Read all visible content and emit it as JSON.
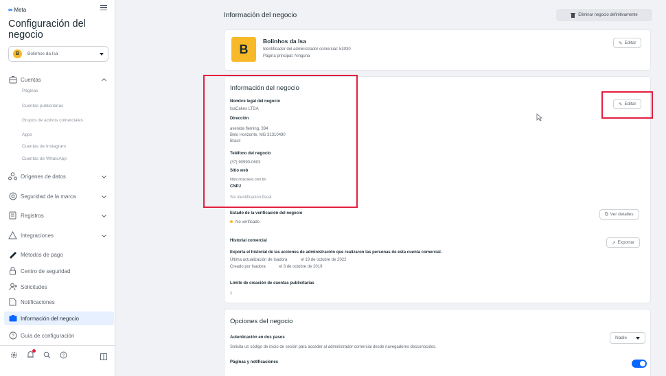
{
  "sidebar": {
    "brand": "Meta",
    "title": "Configuración del negocio",
    "business_select": {
      "initial": "B",
      "name": "Bolinhos da Isa"
    },
    "sections": [
      {
        "label": "Cuentas",
        "icon": "accounts-icon"
      },
      {
        "label": "Orígenes de datos",
        "icon": "data-sources-icon"
      },
      {
        "label": "Seguridad de la marca",
        "icon": "brand-safety-icon"
      },
      {
        "label": "Registros",
        "icon": "registers-icon"
      },
      {
        "label": "Integraciones",
        "icon": "integrations-icon"
      },
      {
        "label": "Métodos de pago",
        "icon": "payment-icon"
      },
      {
        "label": "Centro de seguridad",
        "icon": "security-center-icon"
      },
      {
        "label": "Solicitudes",
        "icon": "requests-icon"
      },
      {
        "label": "Notificaciones",
        "icon": "notifications-icon"
      },
      {
        "label": "Información del negocio",
        "icon": "business-info-icon"
      },
      {
        "label": "Guía de configuración",
        "icon": "setup-guide-icon"
      }
    ],
    "accounts_sub": [
      "Páginas",
      "Cuentas publicitarias",
      "Grupos de activos comerciales",
      "Apps",
      "Cuentas de Instagram",
      "Cuentas de WhatsApp"
    ],
    "bottom_icons": [
      "settings-icon",
      "notifications-bell-icon",
      "search-icon",
      "help-icon",
      "panel-icon"
    ]
  },
  "main": {
    "title": "Información del negocio",
    "delete_button": "Eliminar negocio definitivamente",
    "profile": {
      "initial": "B",
      "name": "Bolinhos da Isa",
      "admin_id": "Identificador del administrador comercial: 53030",
      "main_page": "Página principal: Ninguna",
      "edit": "Editar"
    },
    "info": {
      "title": "Información del negocio",
      "edit": "Editar",
      "legal_name_label": "Nombre legal del negocio",
      "legal_name": "IsaCakes LTDA",
      "address_label": "Dirección",
      "address_lines": [
        "avenida fleming, 394",
        "Belo Horizonte, MG 31310490",
        "Brasil"
      ],
      "phone_label": "Teléfono del negocio",
      "phone": "(37) 90990-0603",
      "website_label": "Sitio web",
      "website": "https://isacakes.com.br/",
      "cnpj_label": "CNPJ",
      "cnpj": "Sin identificación fiscal",
      "verification_label": "Estado de la verificación del negocio",
      "verification_status": "No verificado",
      "view_details": "Ver detalles",
      "history_label": "Historial comercial",
      "history_desc": "Exporta el historial de las acciones de administración que realizaron las personas de esta cuenta comercial.",
      "history_update": "Última actualización de Isadora",
      "history_update_date": "el 19 de octubre de 2022",
      "history_created": "Creado por Isadora",
      "history_created_date": "el 3 de octubre de 2019",
      "export": "Exportar",
      "ad_limit_label": "Límite de creación de cuentas publicitarias",
      "ad_limit": "1"
    },
    "options": {
      "title": "Opciones del negocio",
      "twofa_label": "Autenticación en dos pasos",
      "twofa_desc": "Solicita un código de inicio de sesión para acceder al administrador comercial desde navegadores desconocidos.",
      "twofa_value": "Nadie",
      "pages_label": "Páginas y notificaciones"
    }
  }
}
